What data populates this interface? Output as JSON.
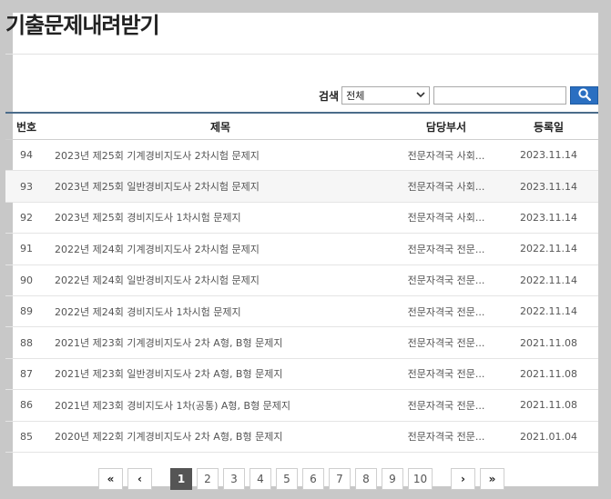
{
  "page": {
    "title": "기출문제내려받기"
  },
  "search": {
    "label": "검색",
    "select_value": "전체",
    "input_value": "",
    "button_color": "#2a6fc1"
  },
  "table": {
    "headers": {
      "no": "번호",
      "title": "제목",
      "dept": "담당부서",
      "date": "등록일"
    },
    "rows": [
      {
        "no": "94",
        "title": "2023년 제25회 기계경비지도사 2차시험 문제지",
        "dept": "전문자격국 사회...",
        "date": "2023.11.14"
      },
      {
        "no": "93",
        "title": "2023년 제25회 일반경비지도사 2차시험 문제지",
        "dept": "전문자격국 사회...",
        "date": "2023.11.14"
      },
      {
        "no": "92",
        "title": "2023년 제25회 경비지도사 1차시험 문제지",
        "dept": "전문자격국 사회...",
        "date": "2023.11.14"
      },
      {
        "no": "91",
        "title": "2022년 제24회 기계경비지도사 2차시험 문제지",
        "dept": "전문자격국 전문...",
        "date": "2022.11.14"
      },
      {
        "no": "90",
        "title": "2022년 제24회 일반경비지도사 2차시험 문제지",
        "dept": "전문자격국 전문...",
        "date": "2022.11.14"
      },
      {
        "no": "89",
        "title": "2022년 제24회 경비지도사 1차시험 문제지",
        "dept": "전문자격국 전문...",
        "date": "2022.11.14"
      },
      {
        "no": "88",
        "title": "2021년 제23회 기계경비지도사 2차 A형, B형 문제지",
        "dept": "전문자격국 전문...",
        "date": "2021.11.08"
      },
      {
        "no": "87",
        "title": "2021년 제23회 일반경비지도사 2차 A형, B형 문제지",
        "dept": "전문자격국 전문...",
        "date": "2021.11.08"
      },
      {
        "no": "86",
        "title": "2021년 제23회 경비지도사 1차(공통) A형, B형 문제지",
        "dept": "전문자격국 전문...",
        "date": "2021.11.08"
      },
      {
        "no": "85",
        "title": "2020년 제22회 기계경비지도사 2차 A형, B형 문제지",
        "dept": "전문자격국 전문...",
        "date": "2021.01.04"
      }
    ]
  },
  "pagination": {
    "first": "«",
    "prev": "‹",
    "pages": [
      "1",
      "2",
      "3",
      "4",
      "5",
      "6",
      "7",
      "8",
      "9",
      "10"
    ],
    "current": "1",
    "next": "›",
    "last": "»"
  }
}
